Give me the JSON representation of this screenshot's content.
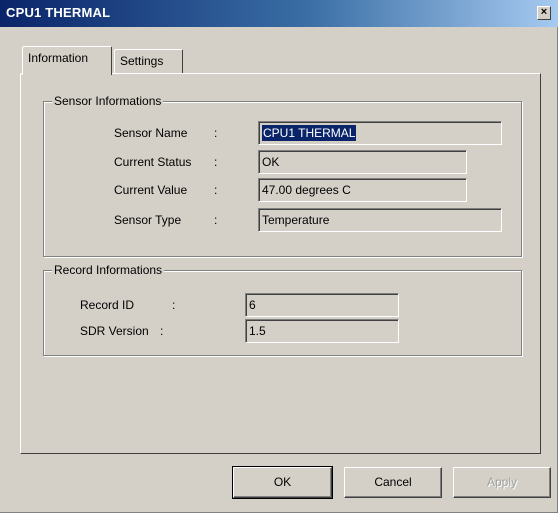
{
  "window": {
    "title": "CPU1 THERMAL",
    "close_glyph": "×"
  },
  "tabs": [
    {
      "label": "Information",
      "active": true
    },
    {
      "label": "Settings",
      "active": false
    }
  ],
  "sensor_group": {
    "title": "Sensor Informations",
    "fields": [
      {
        "label": "Sensor Name",
        "value": "CPU1 THERMAL",
        "selected": true
      },
      {
        "label": "Current Status",
        "value": "OK"
      },
      {
        "label": "Current Value",
        "value": "47.00 degrees C"
      },
      {
        "label": "Sensor Type",
        "value": "Temperature"
      }
    ]
  },
  "record_group": {
    "title": "Record Informations",
    "fields": [
      {
        "label": "Record ID",
        "value": "6"
      },
      {
        "label": "SDR Version",
        "value": "1.5"
      }
    ]
  },
  "buttons": {
    "ok": "OK",
    "cancel": "Cancel",
    "apply": "Apply"
  },
  "colon": ":"
}
